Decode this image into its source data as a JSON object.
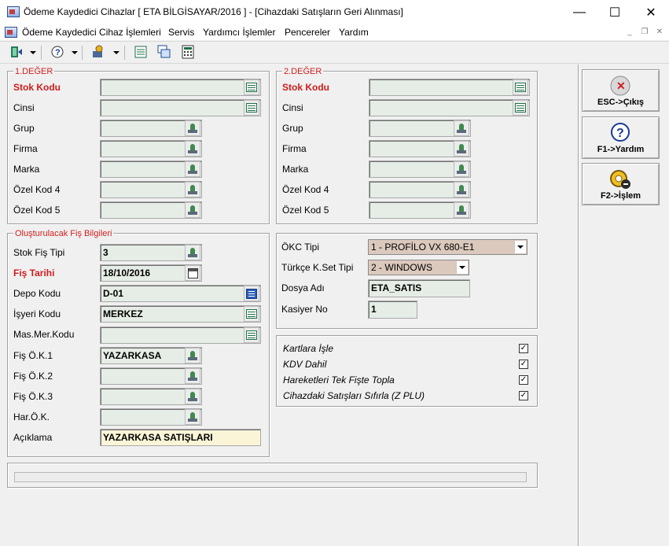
{
  "window": {
    "title": "Ödeme Kaydedici Cihazlar [ ETA BİLGİSAYAR/2016 ] - [Cihazdaki Satışların Geri Alınması]",
    "minimize": "—",
    "maximize": "☐",
    "close": "✕"
  },
  "menu": {
    "items": [
      "Ödeme Kaydedici Cihaz İşlemleri",
      "Servis",
      "Yardımcı İşlemler",
      "Pencereler",
      "Yardım"
    ],
    "mdi_min": "_",
    "mdi_restore": "❐",
    "mdi_close": "✕"
  },
  "panel1": {
    "legend": "1.DEĞER",
    "labels": [
      "Stok Kodu",
      "Cinsi",
      "Grup",
      "Firma",
      "Marka",
      "Özel Kod 4",
      "Özel Kod 5"
    ]
  },
  "panel2": {
    "legend": "2.DEĞER",
    "labels": [
      "Stok Kodu",
      "Cinsi",
      "Grup",
      "Firma",
      "Marka",
      "Özel Kod 4",
      "Özel Kod 5"
    ]
  },
  "fis": {
    "legend": "Oluşturulacak Fiş Bilgileri",
    "labels": [
      "Stok Fiş Tipi",
      "Fiş Tarihi",
      "Depo Kodu",
      "İşyeri Kodu",
      "Mas.Mer.Kodu",
      "Fiş Ö.K.1",
      "Fiş Ö.K.2",
      "Fiş Ö.K.3",
      "Har.Ö.K.",
      "Açıklama"
    ],
    "values": {
      "stok_fis_tipi": "3",
      "fis_tarihi": "18/10/2016",
      "depo_kodu": "D-01",
      "isyeri_kodu": "MERKEZ",
      "mas_mer_kodu": "",
      "fis_ok1": "YAZARKASA",
      "fis_ok2": "",
      "fis_ok3": "",
      "har_ok": "",
      "aciklama": "YAZARKASA SATIŞLARI"
    }
  },
  "okc": {
    "labels": [
      "ÖKC Tipi",
      "Türkçe K.Set Tipi",
      "Dosya Adı",
      "Kasiyer No"
    ],
    "okc_tipi": "1 - PROFİLO VX 680-E1",
    "kset_tipi": "2 - WINDOWS",
    "dosya_adi": "ETA_SATIS",
    "kasiyer_no": "1"
  },
  "options": [
    {
      "label": "Kartlara İşle",
      "checked": true
    },
    {
      "label": "KDV Dahil",
      "checked": true
    },
    {
      "label": "Hareketleri Tek Fişte Topla",
      "checked": true
    },
    {
      "label": "Cihazdaki Satışları Sıfırla (Z PLU)",
      "checked": true
    }
  ],
  "check_mark": "✓",
  "side_buttons": {
    "esc": "ESC->Çıkış",
    "f1": "F1->Yardım",
    "f2": "F2->İşlem",
    "esc_glyph": "✕",
    "f1_glyph": "?"
  },
  "colors": {
    "required_label": "#d01c1c",
    "field_bg": "#e6ede6",
    "combo_bg": "#dcc9bd",
    "note_bg": "#fbf5d8"
  }
}
